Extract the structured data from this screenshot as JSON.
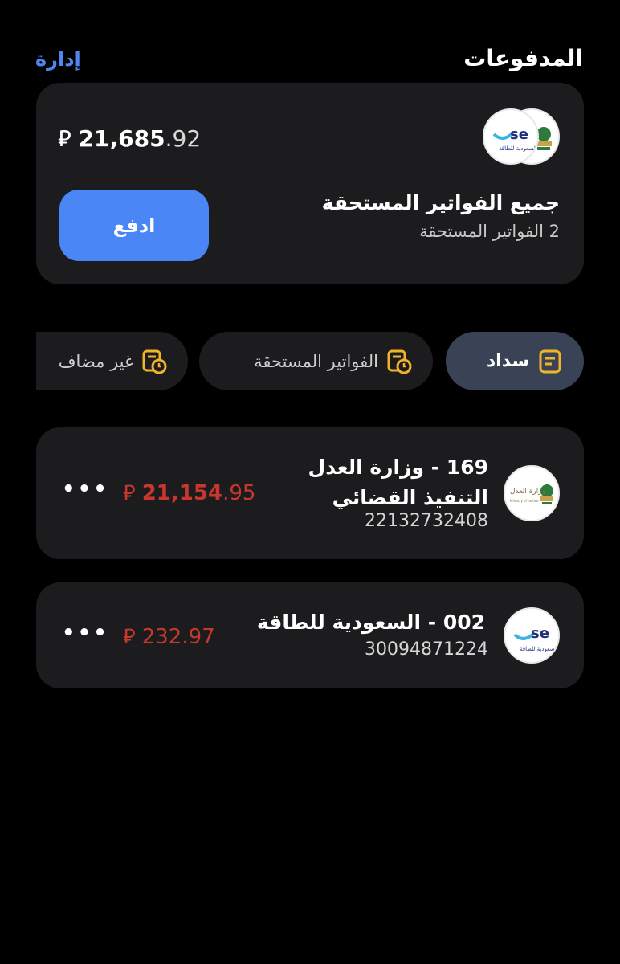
{
  "header": {
    "title": "المدفوعات",
    "manage_label": "إدارة"
  },
  "summary": {
    "currency_symbol": "⃁",
    "amount_int": "21,685",
    "amount_dec": ".92",
    "pay_label": "ادفع",
    "title": "جميع الفواتير المستحقة",
    "subtitle": "2 الفواتير المستحقة"
  },
  "tabs": [
    {
      "label": "سداد",
      "icon": "receipt-icon",
      "active": true
    },
    {
      "label": "الفواتير المستحقة",
      "icon": "due-bill-clock-icon",
      "active": false
    },
    {
      "label": "غير مضاف",
      "icon": "unadded-bill-clock-icon",
      "active": false
    }
  ],
  "bills": [
    {
      "title": "169 - وزارة العدل التنفيذ القضائي",
      "number": "22132732408",
      "amount_int": "21,154",
      "amount_dec": ".95",
      "logo": "ministry-of-justice-logo"
    },
    {
      "title": "002 -  السعودية للطاقة",
      "number": "30094871224",
      "amount_int": "232",
      "amount_dec": ".97",
      "logo": "saudi-electricity-logo"
    }
  ],
  "colors": {
    "accent": "#4a86f5",
    "amount_due": "#c8372d",
    "card_bg": "#1c1c1e",
    "active_tab": "#3a4356",
    "icon_gold": "#f0b429"
  },
  "logo_text": {
    "se_mark": "se",
    "se_arabic": "السعودية للطاقة",
    "moj_arabic": "وزارة العدل",
    "moj_english": "Ministry of Justice"
  }
}
